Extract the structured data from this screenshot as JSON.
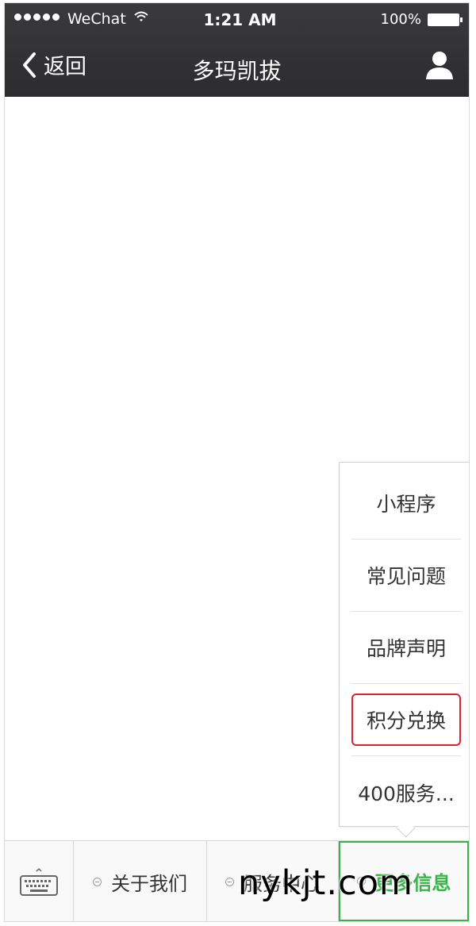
{
  "status_bar": {
    "carrier": "WeChat",
    "time": "1:21 AM",
    "battery": "100%"
  },
  "nav": {
    "back_label": "返回",
    "title": "多玛凯拔",
    "back_icon": "chevron-left-icon",
    "profile_icon": "person-icon"
  },
  "popup_menu": {
    "items": [
      {
        "label": "小程序"
      },
      {
        "label": "常见问题"
      },
      {
        "label": "品牌声明"
      },
      {
        "label": "积分兑换",
        "highlighted": true
      },
      {
        "label": "400服务..."
      }
    ],
    "highlight_color": "#e0202e"
  },
  "bottom_menu": {
    "keyboard_icon": "keyboard-icon",
    "items": [
      {
        "label": "关于我们"
      },
      {
        "label": "服务中心"
      },
      {
        "label": "更多信息",
        "active": true
      }
    ],
    "active_color": "#3cb24a"
  },
  "watermark": "nykjt.com"
}
